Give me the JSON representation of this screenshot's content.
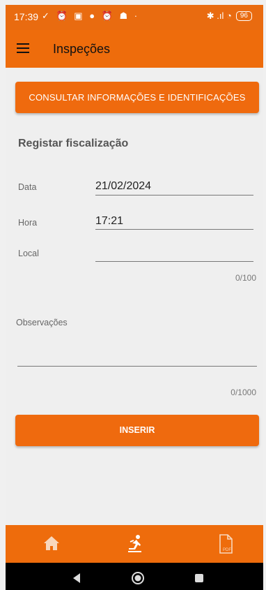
{
  "status_bar": {
    "time": "17:39",
    "icons_left": "✓ ⏰ ▣ ● ⏰ ☗ ·",
    "icons_right": "✱ .ıl ◔",
    "battery": "96"
  },
  "app_bar": {
    "title": "Inspeções"
  },
  "consult_button": {
    "label": "CONSULTAR INFORMAÇÕES E IDENTIFICAÇÕES"
  },
  "form": {
    "section_title": "Registar fiscalização",
    "date": {
      "label": "Data",
      "value": "21/02/2024"
    },
    "time": {
      "label": "Hora",
      "value": "17:21"
    },
    "location": {
      "label": "Local",
      "value": "",
      "counter": "0/100"
    },
    "notes": {
      "label": "Observações",
      "value": "",
      "counter": "0/1000"
    }
  },
  "insert_button": {
    "label": "INSERIR"
  },
  "bottom_nav": [
    {
      "icon": "home-icon"
    },
    {
      "icon": "inspector-icon"
    },
    {
      "icon": "pdf-file-icon",
      "text": "PDF"
    }
  ],
  "colors": {
    "accent": "#ee6c0c",
    "background": "#efefef"
  }
}
